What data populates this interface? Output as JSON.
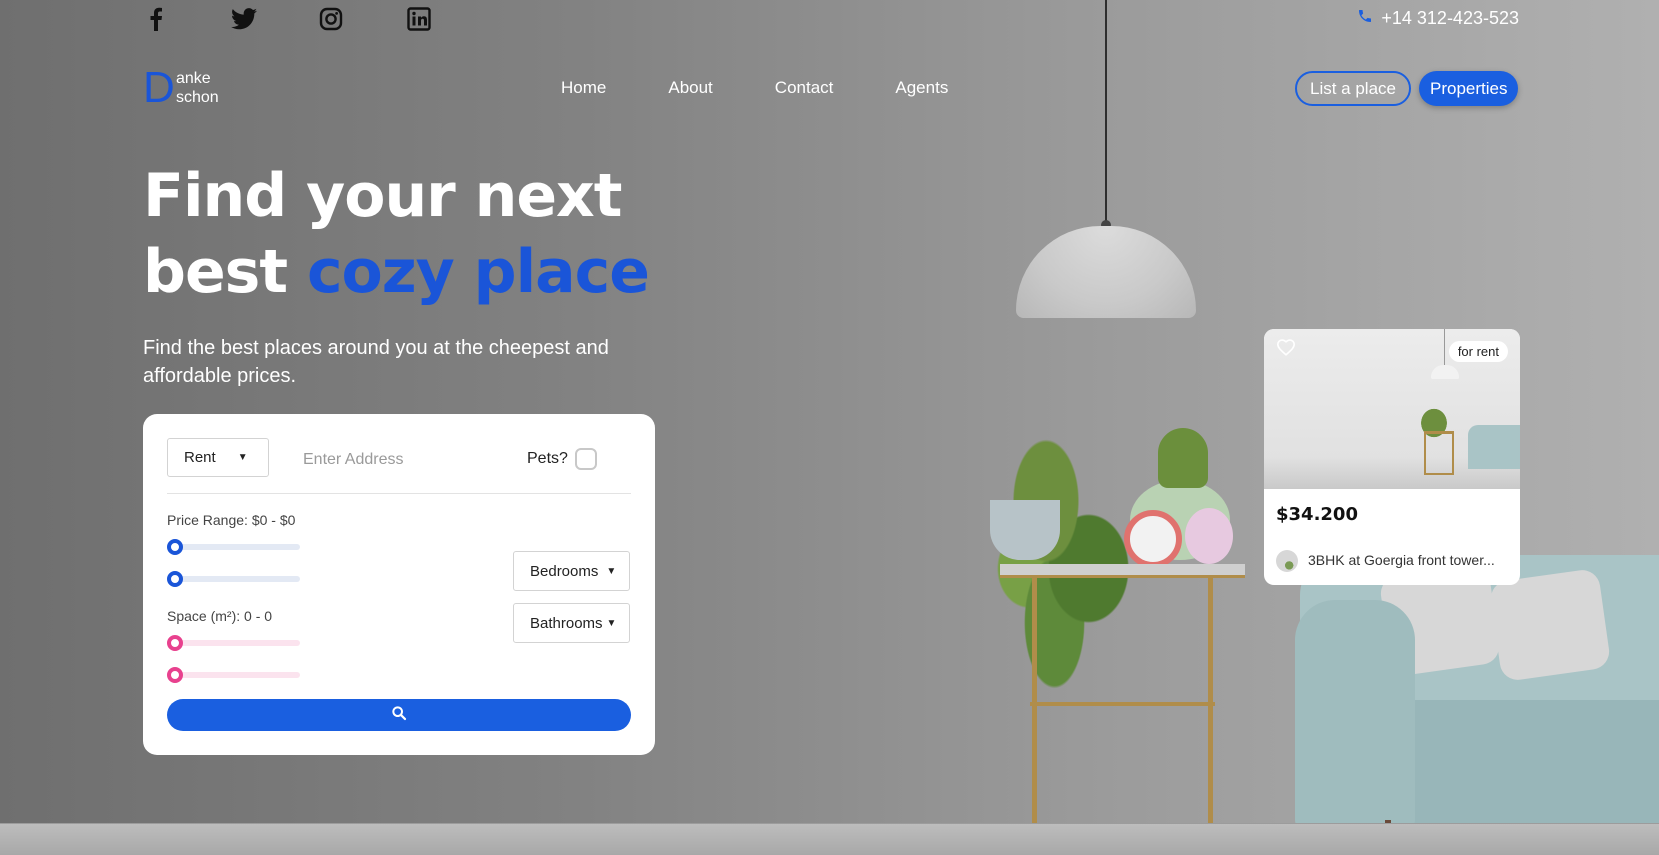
{
  "topbar": {
    "social": [
      "facebook-icon",
      "twitter-icon",
      "instagram-icon",
      "linkedin-icon"
    ],
    "phone": "+14 312-423-523"
  },
  "logo": {
    "letter": "D",
    "line1": "anke",
    "line2": "schon"
  },
  "nav": {
    "items": [
      "Home",
      "About",
      "Contact",
      "Agents"
    ],
    "list_place": "List a place",
    "properties": "Properties"
  },
  "hero": {
    "title_line1": "Find your next",
    "title_line2_plain": "best ",
    "title_line2_accent": "cozy place",
    "subtitle": "Find the best places around you at the cheepest and affordable prices."
  },
  "search": {
    "type_value": "Rent",
    "address_placeholder": "Enter Address",
    "pets_label": "Pets?",
    "price_label": "Price Range: $0 - $0",
    "space_label": "Space (m²): 0 - 0",
    "bedrooms": "Bedrooms",
    "bathrooms": "Bathrooms"
  },
  "listing": {
    "badge": "for rent",
    "price": "$34.200",
    "location": "3BHK at Goergia front tower..."
  },
  "colors": {
    "accent": "#1a5fe0",
    "price_slider": "#1a55d8",
    "space_slider": "#e8418e"
  }
}
